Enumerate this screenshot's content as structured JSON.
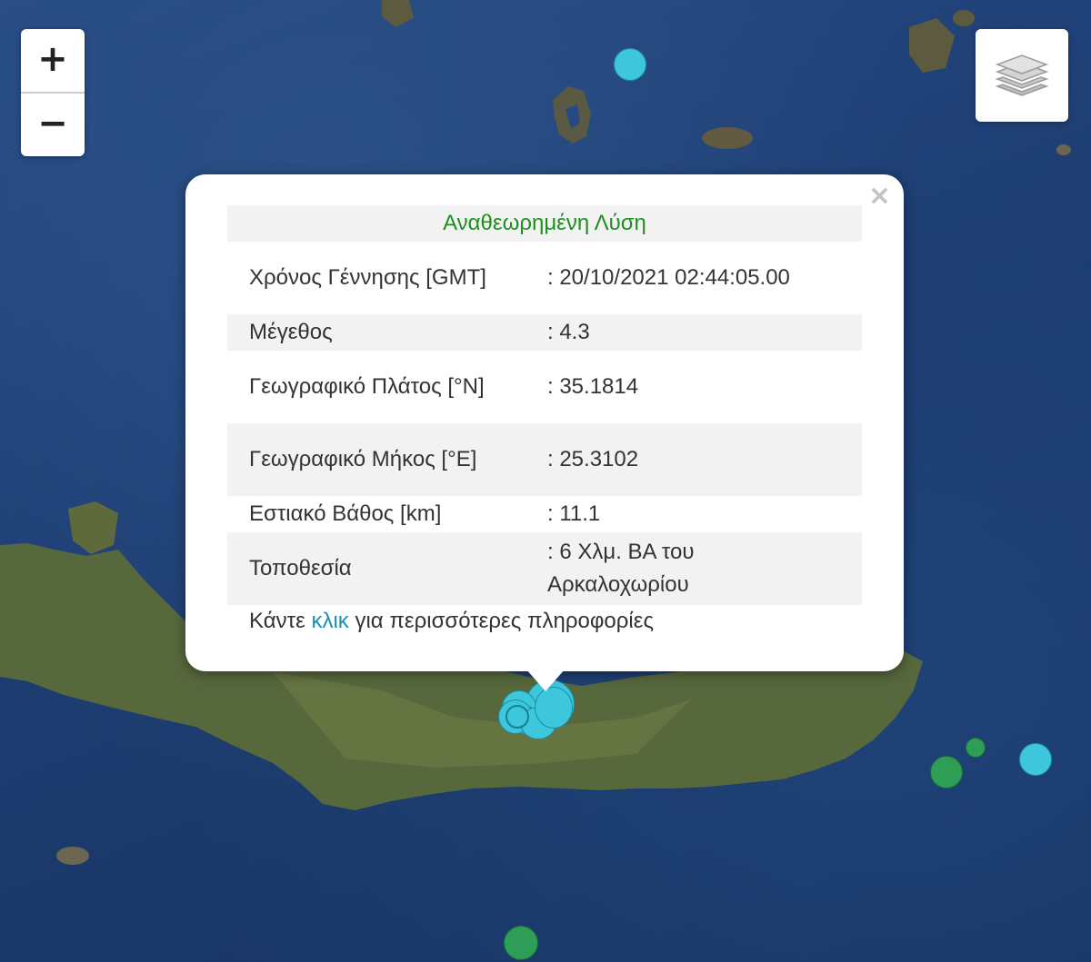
{
  "zoom_control": {
    "zoom_in_label": "+",
    "zoom_out_label": "−"
  },
  "layers_control": {
    "icon": "layers-icon"
  },
  "popup": {
    "close_label": "×",
    "header": "Αναθεωρημένη Λύση",
    "rows": [
      {
        "label": "Χρόνος Γέννησης [GMT]",
        "value": ": 20/10/2021 02:44:05.00"
      },
      {
        "label": "Μέγεθος",
        "value": ": 4.3"
      },
      {
        "label": "Γεωγραφικό Πλάτος [°N]",
        "value": ": 35.1814"
      },
      {
        "label": "Γεωγραφικό Μήκος [°E]",
        "value": ": 25.3102"
      },
      {
        "label": "Εστιακό Βάθος [km]",
        "value": ": 11.1"
      },
      {
        "label": "Τοποθεσία",
        "value": ": 6 Χλμ. ΒΑ του Αρκαλοχωρίου"
      }
    ],
    "footer": {
      "prefix": "Κάντε ",
      "link_text": "κλικ",
      "suffix": " για περισσότερες πληροφορίες"
    }
  },
  "colors": {
    "header_green": "#1f8f1f",
    "link_blue": "#1f8fb8",
    "marker_cyan": "#3ec6dc",
    "marker_green": "#2e9e57"
  }
}
